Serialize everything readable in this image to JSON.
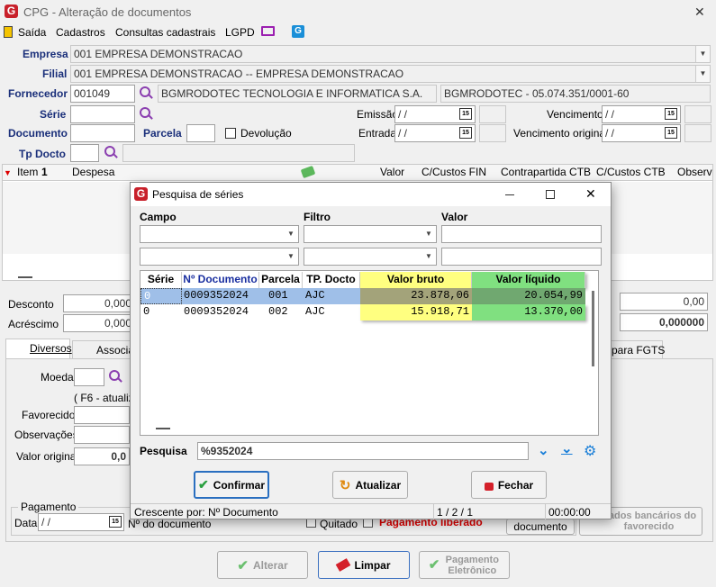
{
  "window": {
    "title": "CPG - Alteração de documentos",
    "close": "✕"
  },
  "menu": [
    "Saída",
    "Cadastros",
    "Consultas cadastrais",
    "LGPD"
  ],
  "form": {
    "empresa_label": "Empresa",
    "empresa_value": "001 EMPRESA DEMONSTRACAO",
    "filial_label": "Filial",
    "filial_value": "001 EMPRESA DEMONSTRACAO -- EMPRESA DEMONSTRACAO",
    "fornecedor_label": "Fornecedor",
    "fornecedor_code": "001049",
    "fornecedor_name": "BGMRODOTEC TECNOLOGIA E INFORMATICA S.A.",
    "fornecedor_cnpj": "BGMRODOTEC - 05.074.351/0001-60",
    "serie_label": "Série",
    "documento_label": "Documento",
    "parcela_label": "Parcela",
    "devolucao_label": "Devolução",
    "tpdocto_label": "Tp Docto",
    "emissao_label": "Emissão",
    "entrada_label": "Entrada",
    "vencimento_label": "Vencimento",
    "venc_original_label": "Vencimento original",
    "date_placeholder": "/ /"
  },
  "grid_headers": {
    "item": "Item",
    "item_num": "1",
    "despesa": "Despesa",
    "valor": "Valor",
    "ccustos_fin": "C/Custos FIN",
    "contrapartida": "Contrapartida CTB",
    "ccustos_ctb": "C/Custos CTB",
    "observ": "Observ"
  },
  "totals": {
    "desconto_label": "Desconto",
    "desconto_value": "0,000",
    "acrescimo_label": "Acréscimo",
    "acrescimo_value": "0,000",
    "right_value1": "0,00",
    "right_value2": "0,000000"
  },
  "tabs": {
    "diversos": "Diversos",
    "associa": "Associa",
    "fgts": "para FGTS"
  },
  "lower": {
    "moeda_label": "Moeda",
    "f6_text": "( F6 - atualiz",
    "favorecido_label": "Favorecido",
    "observacoes_label": "Observações",
    "valor_original_label": "Valor original",
    "valor_original_value": "0,0",
    "pagamento_label": "Pagamento",
    "data_label": "Data",
    "date_value": "/ /",
    "nr_documento_label": "Nº do documento",
    "quitado_label": "Quitado",
    "pagamento_liberado": "Pagamento liberado",
    "documento_btn": "documento",
    "dados_bancarios": "Dados bancários do favorecido"
  },
  "footer_buttons": {
    "alterar": "Alterar",
    "limpar": "Limpar",
    "pagamento_eletronico": "Pagamento Eletrônico"
  },
  "dialog": {
    "title": "Pesquisa de séries",
    "campo_label": "Campo",
    "filtro_label": "Filtro",
    "valor_label": "Valor",
    "columns": [
      "Série",
      "Nº Documento",
      "Parcela",
      "TP. Docto",
      "Valor bruto",
      "Valor líquido"
    ],
    "rows": [
      {
        "serie": "0",
        "documento": "0009352024",
        "parcela": "001",
        "tp": "AJC",
        "bruto": "23.878,06",
        "liquido": "20.054,99"
      },
      {
        "serie": "0",
        "documento": "0009352024",
        "parcela": "002",
        "tp": "AJC",
        "bruto": "15.918,71",
        "liquido": "13.370,00"
      }
    ],
    "pesquisa_label": "Pesquisa",
    "pesquisa_value": "%9352024",
    "confirmar": "Confirmar",
    "atualizar": "Atualizar",
    "fechar": "Fechar",
    "status_order": "Crescente por: Nº Documento",
    "status_page": "1 / 2 / 1",
    "status_time": "00:00:00",
    "colors": {
      "bruto_bg": "#ffff80",
      "liquido_bg": "#80e080",
      "selected_row": "#9fbfe8"
    }
  }
}
